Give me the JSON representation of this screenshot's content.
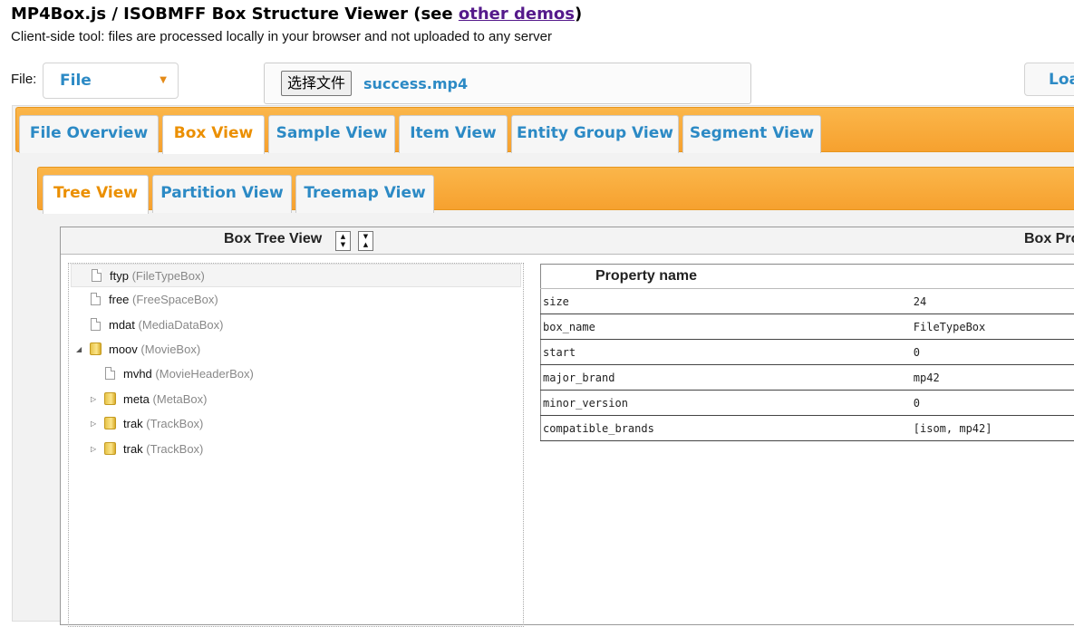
{
  "header": {
    "title_prefix": "MP4Box.js / ISOBMFF Box Structure Viewer (see ",
    "title_link": "other demos",
    "title_suffix": ")",
    "subtitle": "Client-side tool: files are processed locally in your browser and not uploaded to any server"
  },
  "file_row": {
    "label": "File:",
    "source_select": "File",
    "choose_button": "选择文件",
    "file_name": "success.mp4",
    "load_button": "Loa"
  },
  "main_tabs": [
    {
      "label": "File Overview",
      "active": false
    },
    {
      "label": "Box View",
      "active": true
    },
    {
      "label": "Sample View",
      "active": false
    },
    {
      "label": "Item View",
      "active": false
    },
    {
      "label": "Entity Group View",
      "active": false
    },
    {
      "label": "Segment View",
      "active": false
    }
  ],
  "sub_tabs": [
    {
      "label": "Tree View",
      "active": true
    },
    {
      "label": "Partition View",
      "active": false
    },
    {
      "label": "Treemap View",
      "active": false
    }
  ],
  "tree_view": {
    "title": "Box Tree View",
    "right_title": "Box Pro",
    "items": [
      {
        "name": "ftyp",
        "type": "(FileTypeBox)",
        "kind": "file",
        "depth": 0,
        "selected": true
      },
      {
        "name": "free",
        "type": "(FreeSpaceBox)",
        "kind": "file",
        "depth": 0
      },
      {
        "name": "mdat",
        "type": "(MediaDataBox)",
        "kind": "file",
        "depth": 0
      },
      {
        "name": "moov",
        "type": "(MovieBox)",
        "kind": "folder",
        "depth": 0,
        "expanded": true
      },
      {
        "name": "mvhd",
        "type": "(MovieHeaderBox)",
        "kind": "file",
        "depth": 1
      },
      {
        "name": "meta",
        "type": "(MetaBox)",
        "kind": "folder",
        "depth": 1,
        "expanded": false
      },
      {
        "name": "trak",
        "type": "(TrackBox)",
        "kind": "folder",
        "depth": 1,
        "expanded": false
      },
      {
        "name": "trak",
        "type": "(TrackBox)",
        "kind": "folder",
        "depth": 1,
        "expanded": false
      }
    ]
  },
  "properties": {
    "header": "Property name",
    "rows": [
      {
        "name": "size",
        "value": "24"
      },
      {
        "name": "box_name",
        "value": "FileTypeBox"
      },
      {
        "name": "start",
        "value": "0"
      },
      {
        "name": "major_brand",
        "value": "mp42"
      },
      {
        "name": "minor_version",
        "value": "0"
      },
      {
        "name": "compatible_brands",
        "value": "[isom, mp42]"
      }
    ]
  },
  "colors": {
    "accent_blue": "#2c8ac5",
    "active_orange": "#eb8f00",
    "tabbar_orange": "#f6a12f"
  }
}
